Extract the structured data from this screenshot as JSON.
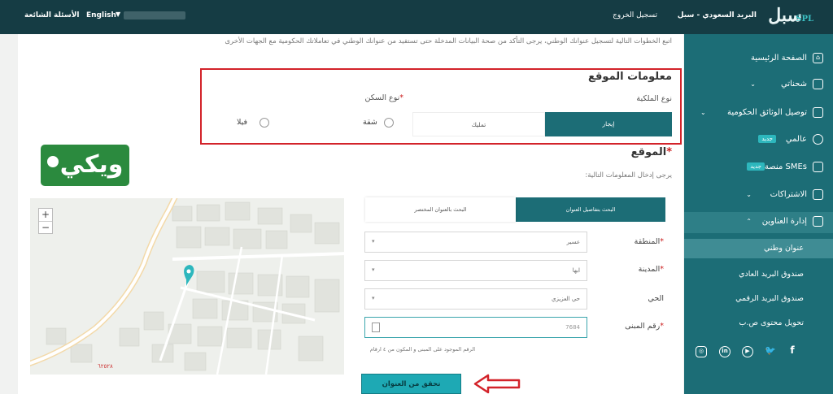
{
  "topbar": {
    "logo": "سبل",
    "logo_small": "SPL",
    "brand": "البريد السعودي - سبل",
    "logout": "تسجيل الخروج",
    "faq": "الأسئلة الشائعة",
    "language": "English"
  },
  "sidebar": {
    "items": [
      {
        "label": "الصفحة الرئيسية",
        "icon": "home-icon"
      },
      {
        "label": "شحناتي",
        "icon": "box-icon"
      },
      {
        "label": "توصيل الوثائق الحكومية",
        "icon": "box-icon"
      },
      {
        "label": "عالمي",
        "icon": "globe-icon",
        "badge": "جديد"
      },
      {
        "label": "منصة SMEs",
        "icon": "box-icon",
        "badge": "جديد"
      },
      {
        "label": "الاشتراكات",
        "icon": "box-icon"
      },
      {
        "label": "إدارة العناوين",
        "icon": "user-icon"
      }
    ],
    "subitems": [
      {
        "label": "عنوان وطني"
      },
      {
        "label": "صندوق البريد العادي"
      },
      {
        "label": "صندوق البريد الرقمي"
      },
      {
        "label": "تحويل محتوى ص.ب"
      }
    ],
    "socials": [
      "instagram-icon",
      "linkedin-icon",
      "youtube-icon",
      "twitter-icon",
      "facebook-icon"
    ]
  },
  "main": {
    "intro": "اتبع الخطوات التالية لتسجيل عنوانك الوطني، يرجى التأكد من صحة البيانات المدخلة حتى تستفيد من عنوانك الوطني في تعاملاتك الحكومية مع الجهات الأخرى",
    "site_info": {
      "title": "معلومات الموقع",
      "ownership_label": "نوع الملكية",
      "ownership_options": [
        "إيجار",
        "تمليك"
      ],
      "housing_label": "نوع السكن",
      "housing_options": [
        "شقة",
        "فيلا"
      ]
    },
    "location": {
      "title": "الموقع",
      "hint": "يرجى إدخال المعلومات التالية:",
      "tabs": [
        "البحث بتفاصيل العنوان",
        "البحث بالعنوان المختصر"
      ],
      "fields": [
        {
          "label": "المنطقة",
          "value": "عسير"
        },
        {
          "label": "المدينة",
          "value": "ابها"
        },
        {
          "label": "الحي",
          "value": "حي العزيزي"
        }
      ],
      "building_label": "رقم المبنى",
      "building_value": "7684",
      "building_hint": "الرقم الموجود على المبنى و المكون من ٤ ارقام",
      "verify_button": "تحقق من العنوان"
    },
    "map": {
      "zoom_in": "+",
      "zoom_out": "−",
      "coord": "٦٢٥٢٨"
    },
    "watermark": "ويكي"
  },
  "colors": {
    "topbar": "#153c44",
    "sidebar": "#1c6d76",
    "accent": "#1ea9b4",
    "highlight": "#d3232a"
  }
}
